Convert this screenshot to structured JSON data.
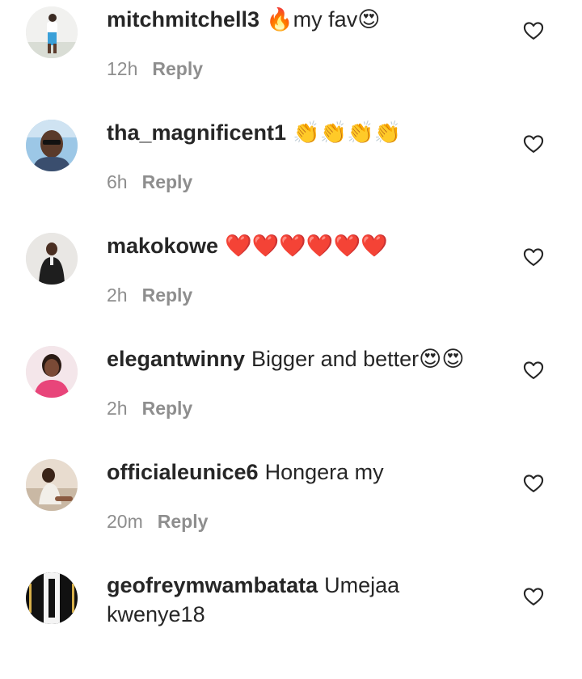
{
  "comments": [
    {
      "username": "mitchmitchell3",
      "text": "🔥my fav😍",
      "time": "12h",
      "reply": "Reply",
      "avatar": "person-standing-avatar"
    },
    {
      "username": "tha_magnificent1",
      "text": "👏👏👏👏",
      "time": "6h",
      "reply": "Reply",
      "avatar": "man-sunglasses-avatar"
    },
    {
      "username": "makokowe",
      "text": "❤️❤️❤️❤️❤️❤️",
      "time": "2h",
      "reply": "Reply",
      "avatar": "man-dark-suit-avatar"
    },
    {
      "username": "elegantwinny",
      "text": "Bigger and better😍😍",
      "time": "2h",
      "reply": "Reply",
      "avatar": "woman-pink-avatar"
    },
    {
      "username": "officialeunice6",
      "text": "Hongera my",
      "time": "20m",
      "reply": "Reply",
      "avatar": "woman-seated-avatar"
    },
    {
      "username": "geofreymwambatata",
      "text": "Umejaa kwenye18",
      "time": "",
      "reply": "",
      "avatar": "mwambata-logo-avatar"
    }
  ],
  "colors": {
    "text": "#262626",
    "meta": "#8e8e8e"
  }
}
